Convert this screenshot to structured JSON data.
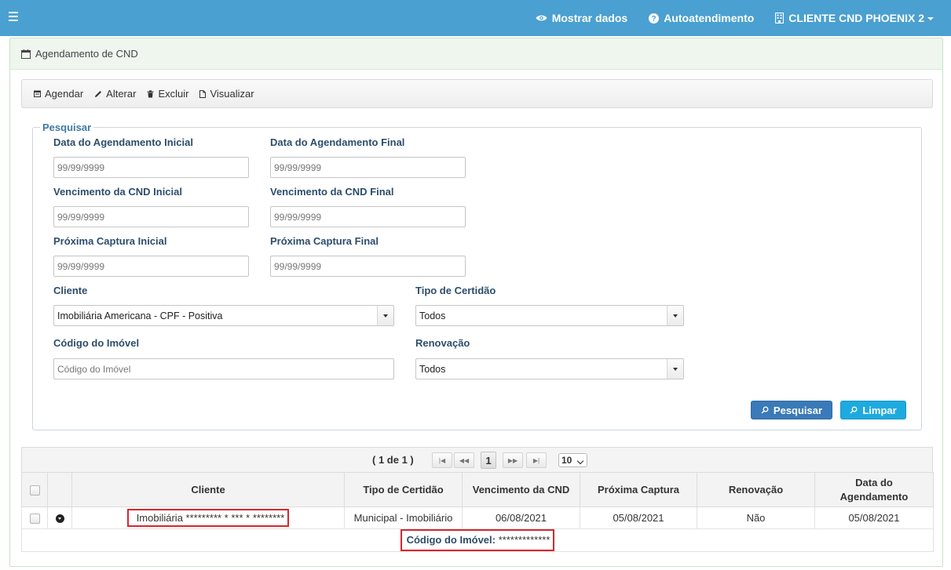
{
  "topbar": {
    "show_data": "Mostrar dados",
    "self_service": "Autoatendimento",
    "client": "CLIENTE CND PHOENIX 2"
  },
  "panel": {
    "title": "Agendamento de CND"
  },
  "toolbar": {
    "schedule": "Agendar",
    "edit": "Alterar",
    "delete": "Excluir",
    "view": "Visualizar"
  },
  "search": {
    "legend": "Pesquisar",
    "date_sched_start": {
      "label": "Data do Agendamento Inicial",
      "placeholder": "99/99/9999"
    },
    "date_sched_end": {
      "label": "Data do Agendamento Final",
      "placeholder": "99/99/9999"
    },
    "cnd_due_start": {
      "label": "Vencimento da CND Inicial",
      "placeholder": "99/99/9999"
    },
    "cnd_due_end": {
      "label": "Vencimento da CND Final",
      "placeholder": "99/99/9999"
    },
    "next_capture_start": {
      "label": "Próxima Captura Inicial",
      "placeholder": "99/99/9999"
    },
    "next_capture_end": {
      "label": "Próxima Captura Final",
      "placeholder": "99/99/9999"
    },
    "client": {
      "label": "Cliente",
      "value": "Imobiliária Americana - CPF - Positiva"
    },
    "cert_type": {
      "label": "Tipo de Certidão",
      "value": "Todos"
    },
    "property_code": {
      "label": "Código do Imóvel",
      "placeholder": "Código do Imóvel"
    },
    "renewal": {
      "label": "Renovação",
      "value": "Todos"
    },
    "search_button": "Pesquisar",
    "clear_button": "Limpar"
  },
  "grid": {
    "page_info": "( 1 de 1 )",
    "current_page": "1",
    "page_size": "10",
    "columns": [
      "Cliente",
      "Tipo de Certidão",
      "Vencimento da CND",
      "Próxima Captura",
      "Renovação",
      "Data do Agendamento"
    ],
    "rows": [
      {
        "client": "Imobiliária ********* * *** * ********",
        "cert_type": "Municipal - Imobiliário",
        "cnd_due": "06/08/2021",
        "next_capture": "05/08/2021",
        "renewal": "Não",
        "sched_date": "05/08/2021"
      }
    ],
    "detail_label": "Código do Imóvel:",
    "detail_value": "*************"
  }
}
